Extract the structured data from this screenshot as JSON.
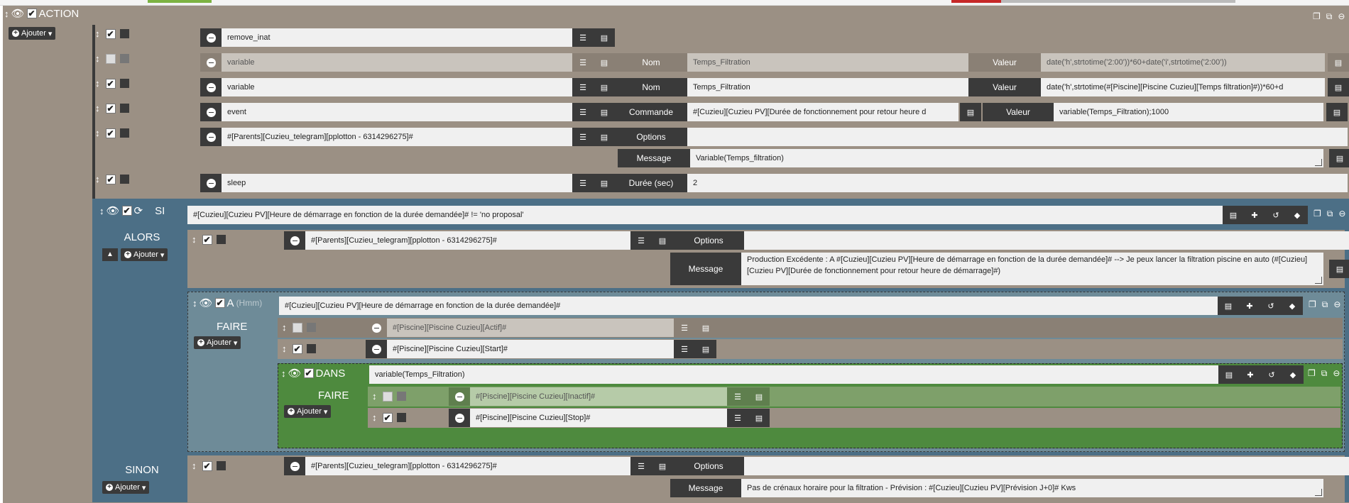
{
  "header": {
    "title": "ACTION",
    "add_label": "Ajouter"
  },
  "actions": [
    {
      "cmd": "remove_inat"
    },
    {
      "cmd": "variable",
      "nom_label": "Nom",
      "nom": "Temps_Filtration",
      "valeur_label": "Valeur",
      "valeur": "date('h',strtotime('2:00'))*60+date('i',strtotime('2:00'))"
    },
    {
      "cmd": "variable",
      "nom_label": "Nom",
      "nom": "Temps_Filtration",
      "valeur_label": "Valeur",
      "valeur": "date('h',strtotime(#[Piscine][Piscine Cuzieu][Temps filtration]#))*60+d"
    },
    {
      "cmd": "event",
      "commande_label": "Commande",
      "commande": "#[Cuzieu][Cuzieu PV][Durée de fonctionnement pour retour heure d",
      "valeur_label": "Valeur",
      "valeur": "variable(Temps_Filtration);1000"
    },
    {
      "cmd": "#[Parents][Cuzieu_telegram][pplotton - 6314296275]#",
      "options_label": "Options",
      "message_label": "Message",
      "message": "Variable(Temps_filtration)"
    },
    {
      "cmd": "sleep",
      "duree_label": "Durée (sec)",
      "duree": "2"
    }
  ],
  "si": {
    "label": "SI",
    "condition": "#[Cuzieu][Cuzieu PV][Heure de démarrage en fonction de la durée demandée]# != 'no proposal'",
    "alors_label": "ALORS",
    "add_label": "Ajouter",
    "alors_cmd": "#[Parents][Cuzieu_telegram][pplotton - 6314296275]#",
    "options_label": "Options",
    "message_label": "Message",
    "alors_message": "Production Excédente : A  #[Cuzieu][Cuzieu PV][Heure de démarrage en fonction de la durée demandée]# --> Je peux lancer la filtration piscine en auto (#[Cuzieu][Cuzieu PV][Durée de fonctionnement pour retour heure de démarrage]#)",
    "a": {
      "label": "A",
      "hint": "(Hmm)",
      "value": "#[Cuzieu][Cuzieu PV][Heure de démarrage en fonction de la durée demandée]#",
      "faire_label": "FAIRE",
      "cmd1": "#[Piscine][Piscine Cuzieu][Actif]#",
      "cmd2": "#[Piscine][Piscine Cuzieu][Start]#",
      "dans": {
        "label": "DANS",
        "value": "variable(Temps_Filtration)",
        "faire_label": "FAIRE",
        "cmd1": "#[Piscine][Piscine Cuzieu][Inactif]#",
        "cmd2": "#[Piscine][Piscine Cuzieu][Stop]#"
      }
    },
    "sinon_label": "SINON",
    "sinon_cmd": "#[Parents][Cuzieu_telegram][pplotton - 6314296275]#",
    "sinon_message": "Pas de crénaux horaire pour la filtration - Prévision :  #[Cuzieu][Cuzieu PV][Prévision J+0]# Kws"
  },
  "colors": {
    "action": "#9b9084",
    "si": "#4c6f86",
    "a": "#6e8b98",
    "dans": "#4e8a3e"
  }
}
